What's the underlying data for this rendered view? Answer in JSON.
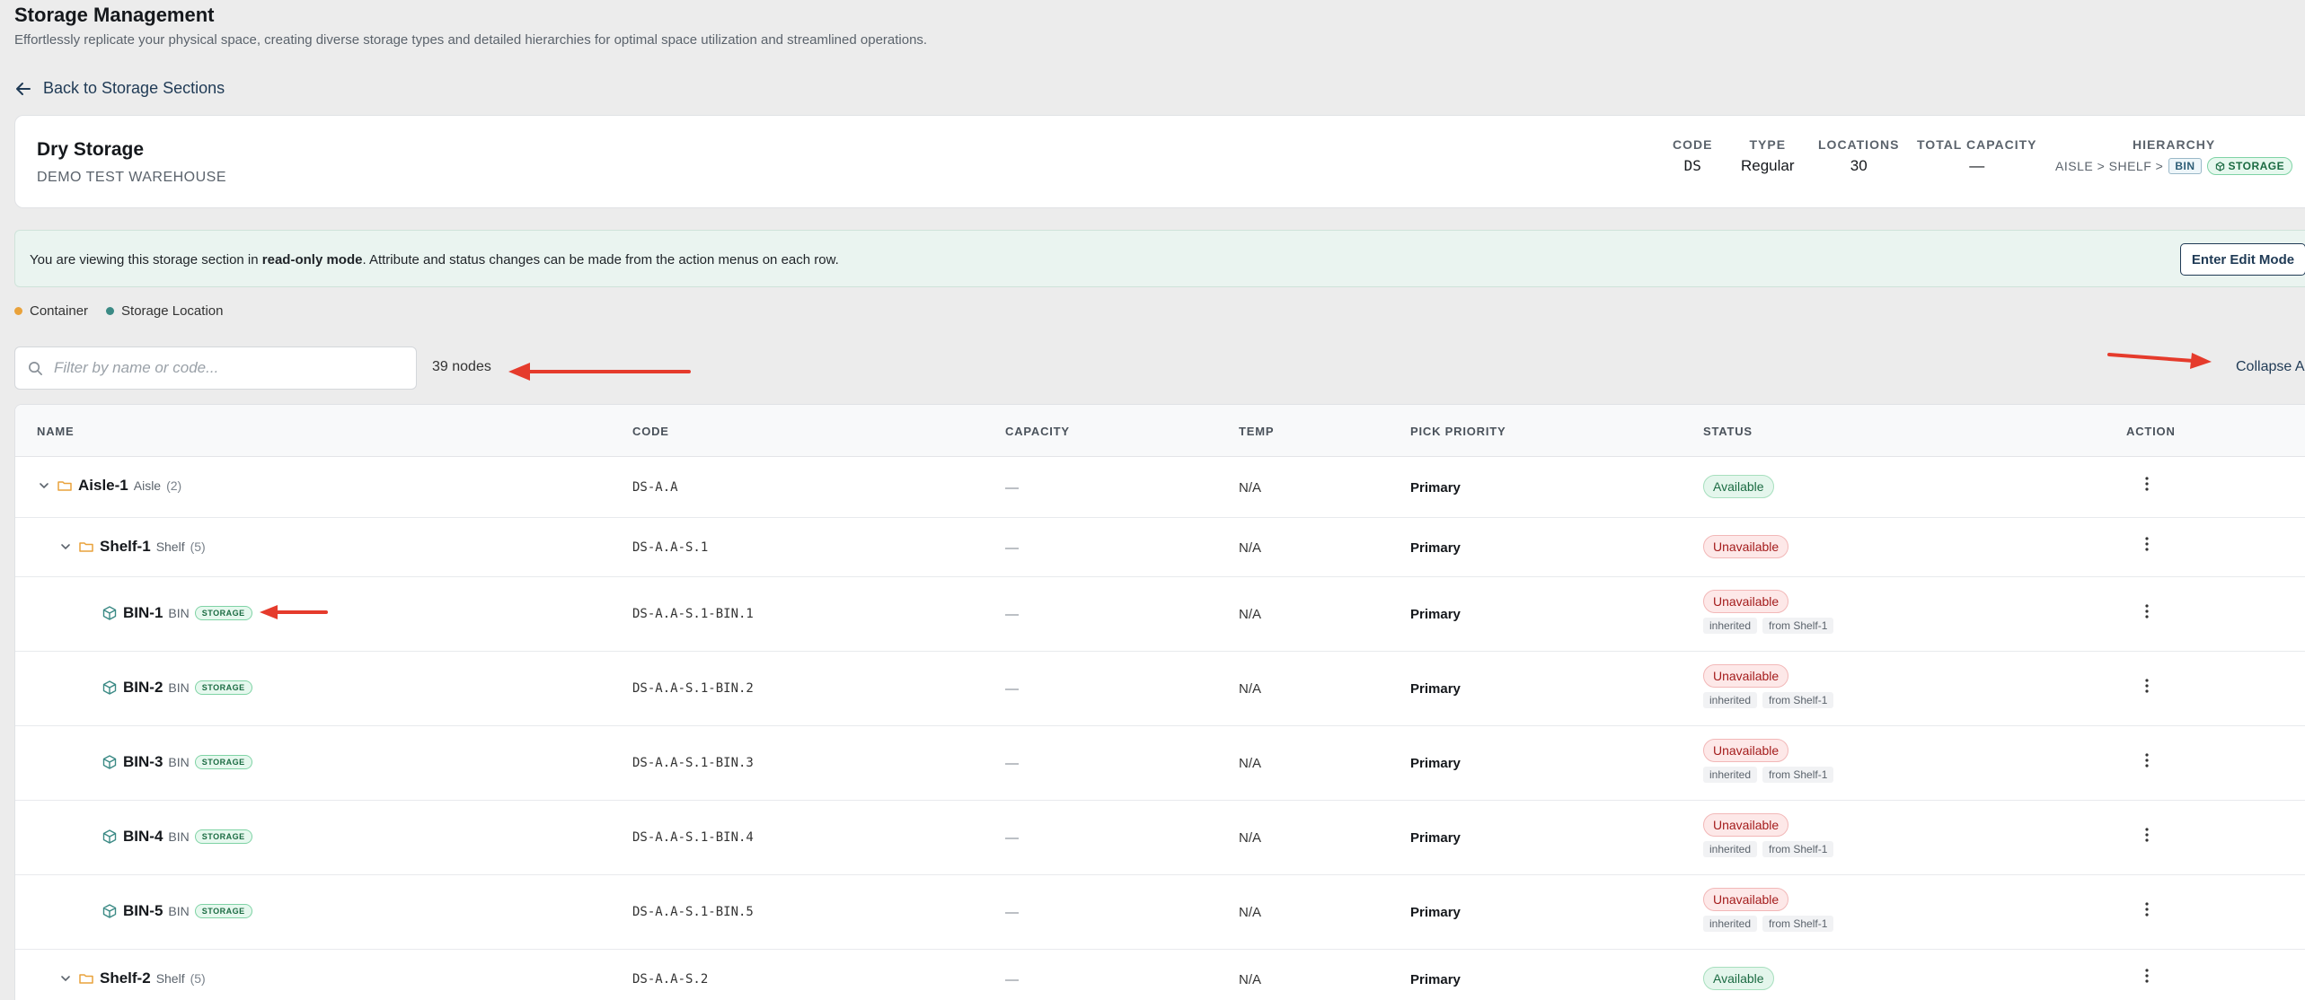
{
  "page": {
    "title": "Storage Management",
    "subtitle": "Effortlessly replicate your physical space, creating diverse storage types and detailed hierarchies for optimal space utilization and streamlined operations."
  },
  "back_link": "Back to Storage Sections",
  "section": {
    "name": "Dry Storage",
    "warehouse": "DEMO TEST WAREHOUSE",
    "code_label": "CODE",
    "code": "DS",
    "type_label": "TYPE",
    "type": "Regular",
    "locations_label": "LOCATIONS",
    "locations": "30",
    "capacity_label": "TOTAL CAPACITY",
    "capacity": "—",
    "hierarchy_label": "HIERARCHY",
    "hierarchy_path": "AISLE > SHELF >",
    "hierarchy_bin": "BIN",
    "hierarchy_storage": "STORAGE"
  },
  "banner": {
    "prefix": "You are viewing this storage section in ",
    "mode": "read-only mode",
    "suffix": ". Attribute and status changes can be made from the action menus on each row.",
    "button": "Enter Edit Mode"
  },
  "legend": {
    "container": "Container",
    "container_color": "#e9a23b",
    "storage_location": "Storage Location",
    "storage_location_color": "#3b8a85"
  },
  "search": {
    "placeholder": "Filter by name or code..."
  },
  "node_count": "39 nodes",
  "collapse_all": "Collapse All",
  "table": {
    "headers": {
      "name": "NAME",
      "code": "CODE",
      "capacity": "CAPACITY",
      "temp": "TEMP",
      "pick_priority": "PICK PRIORITY",
      "status": "STATUS",
      "action": "ACTION"
    },
    "rows": [
      {
        "name": "Aisle-1",
        "type": "Aisle",
        "count": "(2)",
        "code": "DS-A.A",
        "capacity": "—",
        "temp": "N/A",
        "priority": "Primary",
        "status": "Available"
      },
      {
        "name": "Shelf-1",
        "type": "Shelf",
        "count": "(5)",
        "code": "DS-A.A-S.1",
        "capacity": "—",
        "temp": "N/A",
        "priority": "Primary",
        "status": "Unavailable"
      },
      {
        "name": "BIN-1",
        "type": "BIN",
        "badge": "STORAGE",
        "code": "DS-A.A-S.1-BIN.1",
        "capacity": "—",
        "temp": "N/A",
        "priority": "Primary",
        "status": "Unavailable",
        "tag1": "inherited",
        "tag2": "from Shelf-1"
      },
      {
        "name": "BIN-2",
        "type": "BIN",
        "badge": "STORAGE",
        "code": "DS-A.A-S.1-BIN.2",
        "capacity": "—",
        "temp": "N/A",
        "priority": "Primary",
        "status": "Unavailable",
        "tag1": "inherited",
        "tag2": "from Shelf-1"
      },
      {
        "name": "BIN-3",
        "type": "BIN",
        "badge": "STORAGE",
        "code": "DS-A.A-S.1-BIN.3",
        "capacity": "—",
        "temp": "N/A",
        "priority": "Primary",
        "status": "Unavailable",
        "tag1": "inherited",
        "tag2": "from Shelf-1"
      },
      {
        "name": "BIN-4",
        "type": "BIN",
        "badge": "STORAGE",
        "code": "DS-A.A-S.1-BIN.4",
        "capacity": "—",
        "temp": "N/A",
        "priority": "Primary",
        "status": "Unavailable",
        "tag1": "inherited",
        "tag2": "from Shelf-1"
      },
      {
        "name": "BIN-5",
        "type": "BIN",
        "badge": "STORAGE",
        "code": "DS-A.A-S.1-BIN.5",
        "capacity": "—",
        "temp": "N/A",
        "priority": "Primary",
        "status": "Unavailable",
        "tag1": "inherited",
        "tag2": "from Shelf-1"
      },
      {
        "name": "Shelf-2",
        "type": "Shelf",
        "count": "(5)",
        "code": "DS-A.A-S.2",
        "capacity": "—",
        "temp": "N/A",
        "priority": "Primary",
        "status": "Available"
      }
    ]
  },
  "colors": {
    "accent": "#1f3a55",
    "annotation_arrow": "#e53b2c",
    "folder_icon": "#e9a23b",
    "bin_icon": "#3b8a85"
  }
}
